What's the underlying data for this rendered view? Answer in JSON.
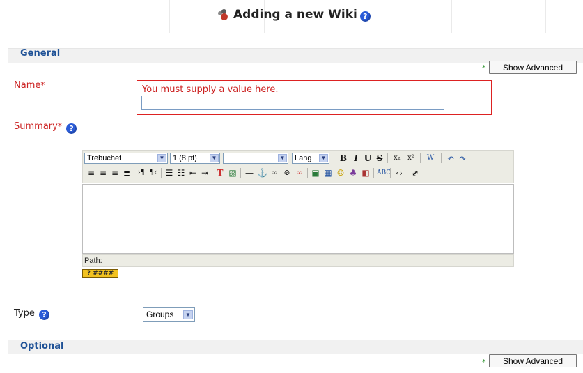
{
  "page": {
    "title": "Adding a new Wiki",
    "help_glyph": "?"
  },
  "general": {
    "legend": "General",
    "show_advanced_label": "Show Advanced",
    "adv_marker": "*"
  },
  "name_field": {
    "label": "Name",
    "required_marker": "*",
    "error_message": "You must supply a value here.",
    "value": ""
  },
  "summary_field": {
    "label": "Summary",
    "required_marker": "*"
  },
  "editor": {
    "font_family": "Trebuchet",
    "font_size": "1 (8 pt)",
    "heading_format": "",
    "language": "Lang",
    "toolbar_row1_icons": [
      "bold-icon",
      "italic-icon",
      "underline-icon",
      "strikethrough-icon",
      "subscript-icon",
      "superscript-icon",
      "paste-word-icon",
      "undo-icon",
      "redo-icon"
    ],
    "toolbar_row2_icons": [
      "align-left-icon",
      "align-center-icon",
      "align-right-icon",
      "justify-icon",
      "ltr-icon",
      "rtl-icon",
      "ordered-list-icon",
      "unordered-list-icon",
      "outdent-icon",
      "indent-icon",
      "text-color-icon",
      "bg-color-icon",
      "horizontal-rule-icon",
      "anchor-icon",
      "link-icon",
      "unlink-icon",
      "nolink-icon",
      "insert-image-icon",
      "insert-table-icon",
      "smiley-icon",
      "special-char-icon",
      "search-replace-icon",
      "spellcheck-icon",
      "html-source-icon",
      "fullscreen-icon"
    ],
    "path_label": "Path:",
    "keyboard_button_text": "? ####"
  },
  "type_field": {
    "label": "Type",
    "selected": "Groups"
  },
  "optional": {
    "legend": "Optional",
    "show_advanced_label": "Show Advanced",
    "adv_marker": "*"
  },
  "colors": {
    "error": "#cc2222",
    "legend": "#1e5196",
    "help": "#2a5bd7"
  }
}
